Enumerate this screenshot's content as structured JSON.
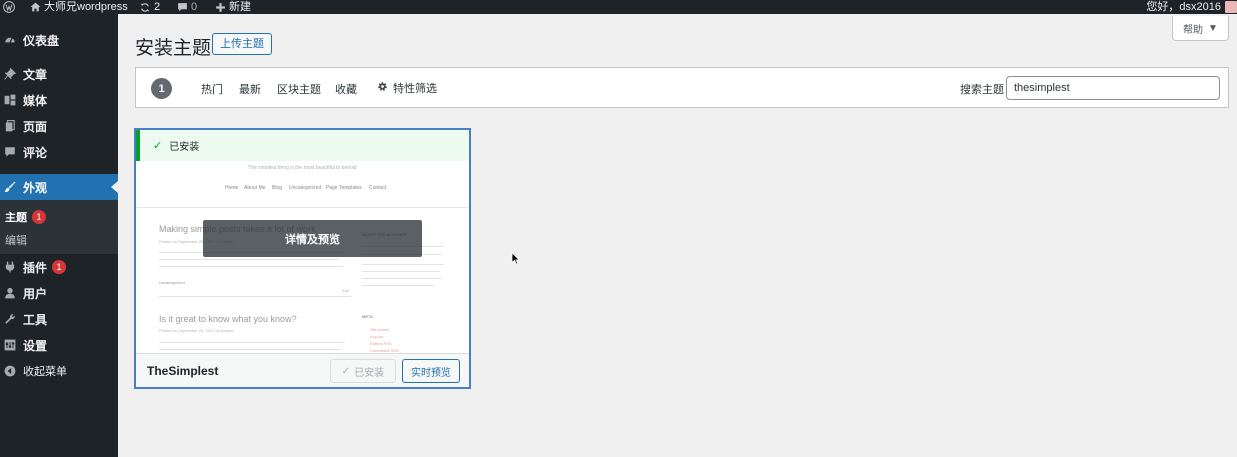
{
  "admin_bar": {
    "site_name": "大师兄wordpress",
    "updates_count": "2",
    "comments_count": "0",
    "new_label": "新建",
    "greeting": "您好，dsx2016"
  },
  "sidebar": {
    "items": [
      {
        "label": "仪表盘",
        "icon": "dashboard-icon"
      },
      {
        "label": "文章",
        "icon": "pin-icon"
      },
      {
        "label": "媒体",
        "icon": "media-icon"
      },
      {
        "label": "页面",
        "icon": "page-icon"
      },
      {
        "label": "评论",
        "icon": "comment-icon"
      },
      {
        "label": "外观",
        "icon": "brush-icon"
      },
      {
        "label": "插件",
        "icon": "plugin-icon",
        "badge": "1"
      },
      {
        "label": "用户",
        "icon": "user-icon"
      },
      {
        "label": "工具",
        "icon": "wrench-icon"
      },
      {
        "label": "设置",
        "icon": "settings-icon"
      },
      {
        "label": "收起菜单",
        "icon": "collapse-icon"
      }
    ],
    "submenu": [
      {
        "label": "主题",
        "badge": "1"
      },
      {
        "label": "编辑"
      }
    ]
  },
  "header": {
    "title": "安装主题",
    "upload_label": "上传主题",
    "help_label": "帮助"
  },
  "filter_bar": {
    "count": "1",
    "links": [
      "热门",
      "最新",
      "区块主题",
      "收藏"
    ],
    "feature_filter": "特性筛选",
    "search_label": "搜索主题",
    "search_value": "thesimplest"
  },
  "theme_card": {
    "notice": "已安装",
    "overlay": "详情及预览",
    "name": "TheSimplest",
    "installed_label": "已安装",
    "preview_label": "实时预览",
    "screenshot": {
      "tagline": "The simplest thing is the most beautiful to behold",
      "nav": [
        "Home",
        "About Me",
        "Blog",
        "Uncategorized",
        "Page Templates",
        "Contact"
      ],
      "post1_title": "Making simple posts takes a lot of work",
      "post1_meta": "Posted on September 28, 2017 by tsimple",
      "post1_category": "Uncategorized",
      "post1_edit": "Edit",
      "post2_title": "Is it great to know what you know?",
      "post2_meta": "Posted on September 24, 2017 by tsimple",
      "sidebar_heading_1": "ABOUT THE BLOGGER",
      "sidebar_heading_2": "META",
      "meta_links": [
        "Site Admin",
        "Log out",
        "Entries RSS",
        "Comments RSS"
      ]
    }
  },
  "colors": {
    "adminbar_bg": "#1d2327",
    "accent": "#2271b1",
    "badge": "#d63638",
    "success": "#00a32a"
  }
}
